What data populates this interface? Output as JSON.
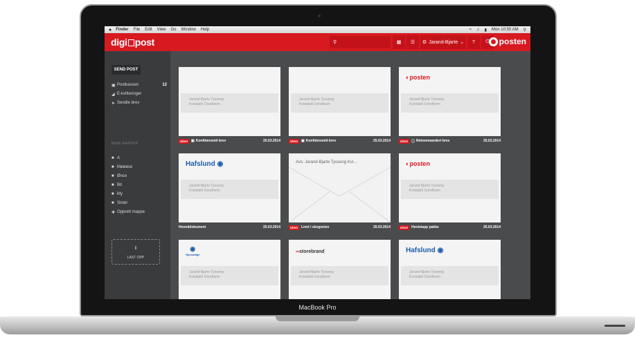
{
  "device": {
    "model": "MacBook Pro"
  },
  "menubar": {
    "apple": "",
    "items": [
      "Finder",
      "File",
      "Edit",
      "View",
      "Go",
      "Window",
      "Help"
    ],
    "clock": "Mon 10:50 AM"
  },
  "topbar": {
    "logo_left": "digi",
    "logo_right": "post",
    "user": "Jarand-Bjarte",
    "help": "?",
    "brand": "posten"
  },
  "sidebar": {
    "send_button": "SEND POST",
    "items": [
      {
        "label": "Postkassen",
        "icon": "inbox-icon",
        "count": "12"
      },
      {
        "label": "E-kvitteringer",
        "icon": "tag-icon"
      },
      {
        "label": "Sendte brev",
        "icon": "send-icon"
      }
    ],
    "folders_heading": "MINE MAPPER",
    "folders": [
      "A",
      "Møøøse",
      "Ønce",
      "Bit",
      "My",
      "Sister"
    ],
    "create_folder": "Opprett mappe",
    "upload": "LAST OPP"
  },
  "cards": [
    {
      "brand": "",
      "address": [
        "Jarand-Bjarte Tysseng",
        "Kvistdahl Grindheim"
      ],
      "unread": "Ulest",
      "title": "Konfidensielt brev",
      "icon": "lock-icon",
      "date": "25.03.2014"
    },
    {
      "brand": "",
      "address": [
        "Jarand-Bjarte Tysseng",
        "Kvistdahl Grindheim"
      ],
      "unread": "Ulest",
      "title": "Konfidensielt brev",
      "icon": "lock-icon",
      "date": "25.03.2014"
    },
    {
      "brand": "posten",
      "address": [
        "Jarand-Bjarte Tysseng",
        "Kvistdahl Grindheim"
      ],
      "unread": "Ulest",
      "title": "Rekommandert brev",
      "icon": "info-icon",
      "date": "25.03.2014"
    },
    {
      "brand": "Hafslund",
      "address": [
        "Jarand-Bjarte Tysseng",
        "Kvistdahl Grindheim"
      ],
      "unread": "",
      "title": "Hoveddokument",
      "icon": "",
      "date": "25.03.2014"
    },
    {
      "brand": "",
      "envelope_text": "Avs: Jarand-Bjarte Tysseng Kvi...",
      "unread": "Ulest",
      "title": "Livet i skogveien",
      "icon": "",
      "date": "25.03.2014"
    },
    {
      "brand": "posten",
      "address": [
        "Jarand-Bjarte Tysseng",
        "Kvistdahl Grindheim"
      ],
      "unread": "Ulest",
      "title": "Hentelapp pakke",
      "icon": "",
      "date": "25.03.2014"
    },
    {
      "brand": "Gjensidige",
      "address": [
        "Jarand-Bjarte Tysseng",
        "Kvistdahl Grindheim"
      ]
    },
    {
      "brand": "storebrand",
      "address": [
        "Jarand-Bjarte Tysseng",
        "Kvistdahl Grindheim"
      ]
    },
    {
      "brand": "Hafslund",
      "address": [
        "Jarand-Bjarte Tysseng",
        "Kvistdahl Grindheim"
      ]
    }
  ],
  "colors": {
    "brand_red": "#d71920",
    "sidebar": "#3a3b3d",
    "content": "#4a4b4d"
  }
}
